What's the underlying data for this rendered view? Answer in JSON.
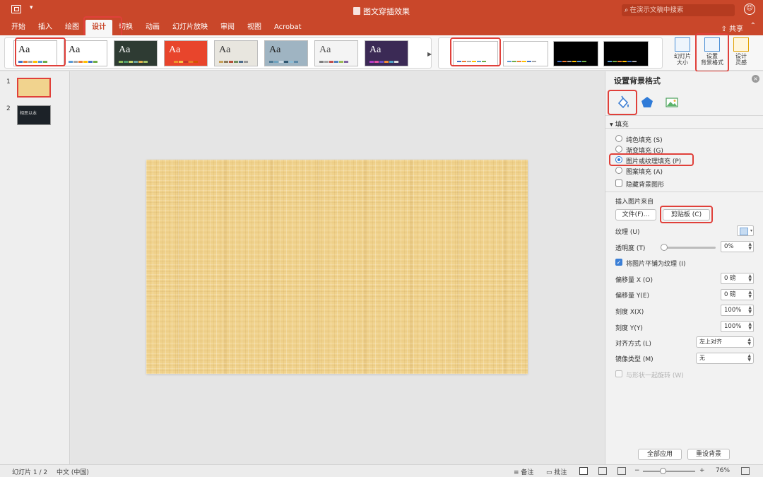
{
  "app": {
    "title": "图文穿插效果",
    "search_placeholder": "在演示文稿中搜索",
    "share": "共享"
  },
  "ribbon_tabs": [
    "开始",
    "插入",
    "绘图",
    "设计",
    "切换",
    "动画",
    "幻灯片放映",
    "审阅",
    "视图",
    "Acrobat"
  ],
  "active_tab": "设计",
  "themes": [
    {
      "aa": "Aa",
      "bg": "#ffffff",
      "fg": "#222222",
      "colors": [
        "#4472c4",
        "#ed7d31",
        "#a5a5a5",
        "#ffc000",
        "#5b9bd5",
        "#70ad47"
      ]
    },
    {
      "aa": "Aa",
      "bg": "#ffffff",
      "fg": "#222222",
      "colors": [
        "#5b9bd5",
        "#a5a5a5",
        "#ed7d31",
        "#ffc000",
        "#4472c4",
        "#70ad47"
      ]
    },
    {
      "aa": "Aa",
      "bg": "#2e3b33",
      "fg": "#ffffff",
      "colors": [
        "#8fbf5a",
        "#4e9a6e",
        "#c4d66b",
        "#6aa3a0",
        "#e2b44f",
        "#a4c466"
      ]
    },
    {
      "aa": "Aa",
      "bg": "#e8452c",
      "fg": "#ffffff",
      "colors": [
        "#e8452c",
        "#f0932b",
        "#f6c344",
        "#c0392b",
        "#e67e22",
        "#d35400"
      ]
    },
    {
      "aa": "Aa",
      "bg": "#e8e6df",
      "fg": "#333333",
      "colors": [
        "#c8a15a",
        "#8c7a5b",
        "#b5523b",
        "#6f8f5e",
        "#4f6d8c",
        "#9a9a9a"
      ]
    },
    {
      "aa": "Aa",
      "bg": "#9fb4c2",
      "fg": "#222222",
      "colors": [
        "#4f7a95",
        "#6fa3bf",
        "#c9d8e3",
        "#2e5670",
        "#8fbcd4",
        "#5d8aa8"
      ]
    },
    {
      "aa": "Aa",
      "bg": "#f4f4f4",
      "fg": "#555555",
      "colors": [
        "#7f7f7f",
        "#a5a5a5",
        "#c0504d",
        "#4f81bd",
        "#9bbb59",
        "#8064a2"
      ]
    },
    {
      "aa": "Aa",
      "bg": "#3b2a55",
      "fg": "#ffffff",
      "colors": [
        "#b23cc7",
        "#e04fa3",
        "#6c4fc7",
        "#f28c38",
        "#4fa3c7",
        "#d9d9d9"
      ]
    }
  ],
  "variants": [
    {
      "bg": "#ffffff",
      "colors": [
        "#4472c4",
        "#ed7d31",
        "#a5a5a5",
        "#ffc000",
        "#5b9bd5",
        "#70ad47"
      ]
    },
    {
      "bg": "#ffffff",
      "colors": [
        "#5b9bd5",
        "#70ad47",
        "#ed7d31",
        "#ffc000",
        "#4472c4",
        "#a5a5a5"
      ]
    },
    {
      "bg": "#000000",
      "colors": [
        "#4472c4",
        "#ed7d31",
        "#a5a5a5",
        "#ffc000",
        "#5b9bd5",
        "#70ad47"
      ]
    },
    {
      "bg": "#000000",
      "colors": [
        "#5b9bd5",
        "#70ad47",
        "#ed7d31",
        "#ffc000",
        "#4472c4",
        "#a5a5a5"
      ]
    }
  ],
  "ribbon_buttons": {
    "slide_size": {
      "line1": "幻灯片",
      "line2": "大小"
    },
    "format_background": {
      "line1": "设置",
      "line2": "背景格式"
    },
    "designer": {
      "line1": "设计",
      "line2": "灵感"
    }
  },
  "slides": [
    {
      "num": "1",
      "selected": true
    },
    {
      "num": "2",
      "selected": false,
      "text": "相思以本"
    }
  ],
  "pane": {
    "title": "设置背景格式",
    "section": "填充",
    "fill_options": [
      {
        "label": "纯色填充 (S)",
        "checked": false
      },
      {
        "label": "渐变填充 (G)",
        "checked": false
      },
      {
        "label": "图片或纹理填充 (P)",
        "checked": true
      },
      {
        "label": "图案填充 (A)",
        "checked": false
      }
    ],
    "hide_bg_graphics": "隐藏背景图形",
    "insert_from": "插入图片来自",
    "file_button": "文件(F)...",
    "clipboard_button": "剪贴板 (C)",
    "texture_label": "纹理 (U)",
    "transparency_label": "透明度 (T)",
    "transparency_value": "0%",
    "tile_label": "将图片平铺为纹理 (I)",
    "offset_x_label": "偏移量 X (O)",
    "offset_x_value": "0 磅",
    "offset_y_label": "偏移量 Y(E)",
    "offset_y_value": "0 磅",
    "scale_x_label": "刻度 X(X)",
    "scale_x_value": "100%",
    "scale_y_label": "刻度 Y(Y)",
    "scale_y_value": "100%",
    "align_label": "对齐方式 (L)",
    "align_value": "左上对齐",
    "mirror_label": "镜像类型 (M)",
    "mirror_value": "无",
    "rotate_label": "与形状一起旋转 (W)",
    "apply_all": "全部应用",
    "reset": "重设背景"
  },
  "status": {
    "slide_counter": "幻灯片 1 / 2",
    "language": "中文 (中国)",
    "notes": "备注",
    "comments": "批注",
    "zoom": "76%",
    "zoom_out": "−",
    "zoom_in": "+"
  },
  "colors": {
    "accent": "#c9472a",
    "highlight": "#e0403a",
    "slide_texture": "#f0d28c"
  }
}
